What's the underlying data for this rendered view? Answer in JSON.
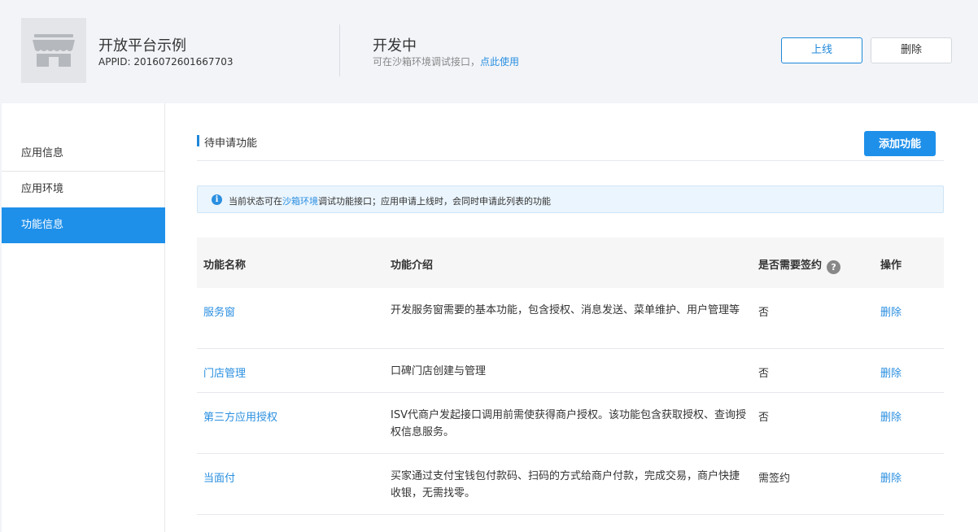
{
  "app": {
    "name": "开放平台示例",
    "appid": "APPID: 2016072601667703",
    "logo_icon": "store-icon"
  },
  "status": {
    "title": "开发中",
    "desc_prefix": "可在沙箱环境调试接口，",
    "desc_link": "点此使用"
  },
  "header_actions": {
    "online_label": "上线",
    "delete_label": "删除"
  },
  "sidebar": {
    "items": [
      {
        "label": "应用信息",
        "active": false
      },
      {
        "label": "应用环境",
        "active": false
      },
      {
        "label": "功能信息",
        "active": true
      }
    ]
  },
  "section": {
    "title": "待申请功能",
    "add_label": "添加功能"
  },
  "notice": {
    "icon": "info-icon",
    "part1": "当前状态可在",
    "link": "沙箱环境",
    "part2": "调试功能接口；应用申请上线时，会同时申请此列表的功能"
  },
  "table": {
    "headers": {
      "name": "功能名称",
      "desc": "功能介绍",
      "sign": "是否需要签约",
      "op": "操作"
    },
    "rows": [
      {
        "name": "服务窗",
        "desc": "开发服务窗需要的基本功能，包含授权、消息发送、菜单维护、用户管理等",
        "sign": "否",
        "op": "删除"
      },
      {
        "name": "门店管理",
        "desc": "口碑门店创建与管理",
        "sign": "否",
        "op": "删除"
      },
      {
        "name": "第三方应用授权",
        "desc": "ISV代商户发起接口调用前需使获得商户授权。该功能包含获取授权、查询授权信息服务。",
        "sign": "否",
        "op": "删除"
      },
      {
        "name": "当面付",
        "desc": "买家通过支付宝钱包付款码、扫码的方式给商户付款，完成交易，商户快捷收银，无需找零。",
        "sign": "需签约",
        "op": "删除"
      }
    ]
  }
}
